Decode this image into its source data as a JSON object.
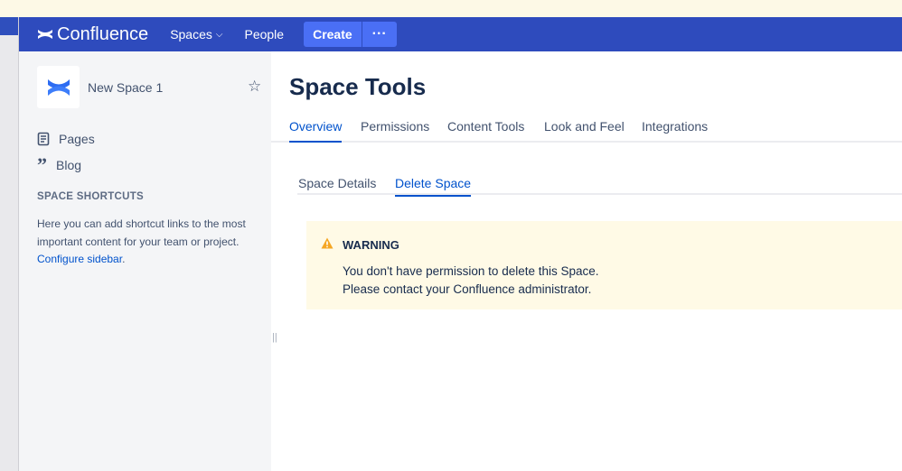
{
  "header": {
    "product": "Confluence",
    "spaces": "Spaces",
    "people": "People",
    "create": "Create",
    "more": "···"
  },
  "sidebar": {
    "space_name": "New Space 1",
    "items": [
      {
        "label": "Pages"
      },
      {
        "label": "Blog"
      }
    ],
    "shortcuts_heading": "SPACE SHORTCUTS",
    "help_text": "Here you can add shortcut links to the most important content for your team or project. ",
    "configure_link": "Configure sidebar",
    "help_end": "."
  },
  "main": {
    "title": "Space Tools",
    "tabs": [
      {
        "label": "Overview"
      },
      {
        "label": "Permissions"
      },
      {
        "label": "Content Tools"
      },
      {
        "label": "Look and Feel"
      },
      {
        "label": "Integrations"
      }
    ],
    "subtabs": [
      {
        "label": "Space Details"
      },
      {
        "label": "Delete Space"
      }
    ],
    "warning": {
      "title": "WARNING",
      "line1": "You don't have permission to delete this Space.",
      "line2": "Please contact your Confluence administrator."
    }
  },
  "colors": {
    "header": "#2e4bbd",
    "accent": "#0052cc",
    "warning_bg": "#fffae6"
  }
}
